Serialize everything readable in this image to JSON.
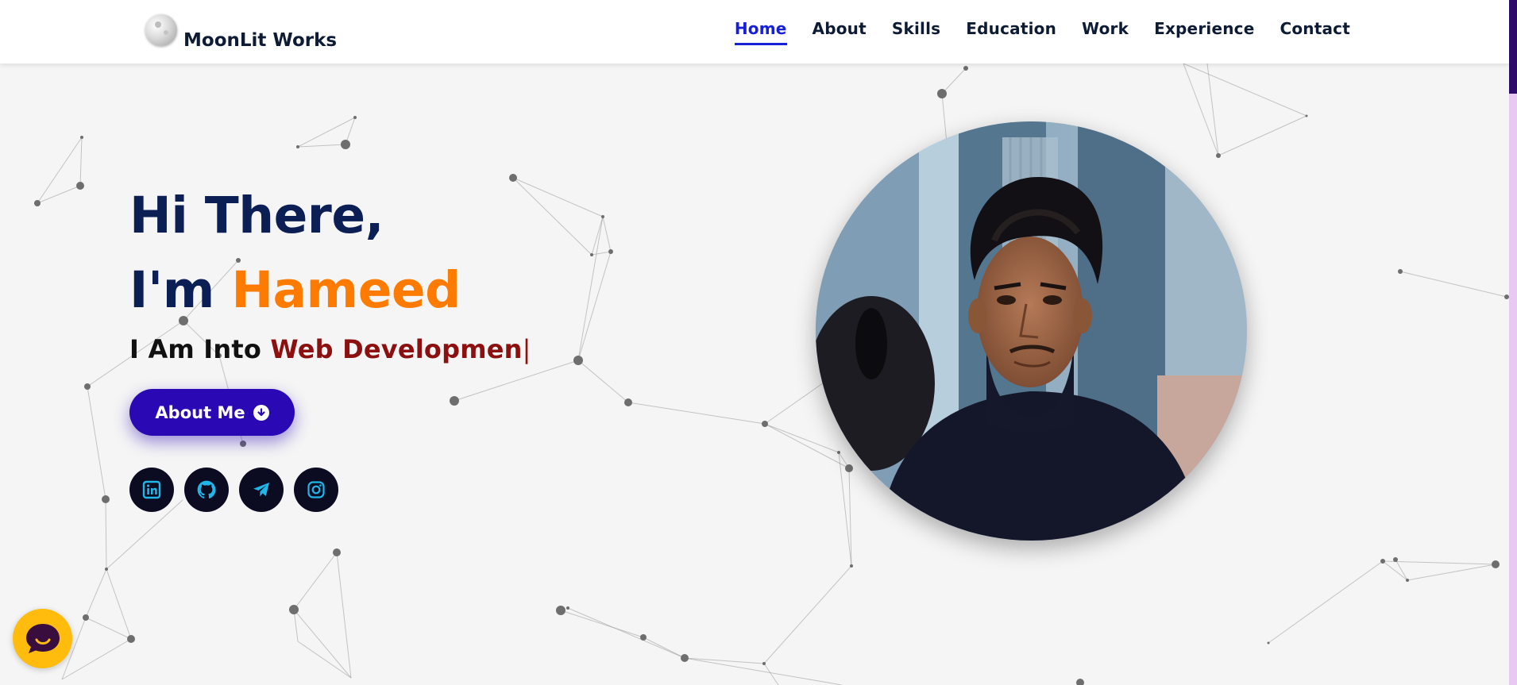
{
  "header": {
    "brand": "MoonLit Works",
    "nav": [
      {
        "label": "Home",
        "active": true
      },
      {
        "label": "About",
        "active": false
      },
      {
        "label": "Skills",
        "active": false
      },
      {
        "label": "Education",
        "active": false
      },
      {
        "label": "Work",
        "active": false
      },
      {
        "label": "Experience",
        "active": false
      },
      {
        "label": "Contact",
        "active": false
      }
    ]
  },
  "hero": {
    "greeting": "Hi There,",
    "intro_prefix": "I'm ",
    "name": "Hameed",
    "typed_prefix": "I Am Into ",
    "typed_role": "Web Developmen",
    "caret": "|",
    "button_label": "About Me",
    "socials": [
      {
        "icon": "linkedin-icon"
      },
      {
        "icon": "github-icon"
      },
      {
        "icon": "telegram-icon"
      },
      {
        "icon": "instagram-icon"
      }
    ]
  },
  "colors": {
    "navy": "#0b1f54",
    "accent_orange": "#ff7b00",
    "role_red": "#8c1010",
    "button_purple": "#2a08b3",
    "nav_active": "#1520d8",
    "social_icon": "#1fb6e8",
    "chat_yellow": "#ffbc0d"
  }
}
